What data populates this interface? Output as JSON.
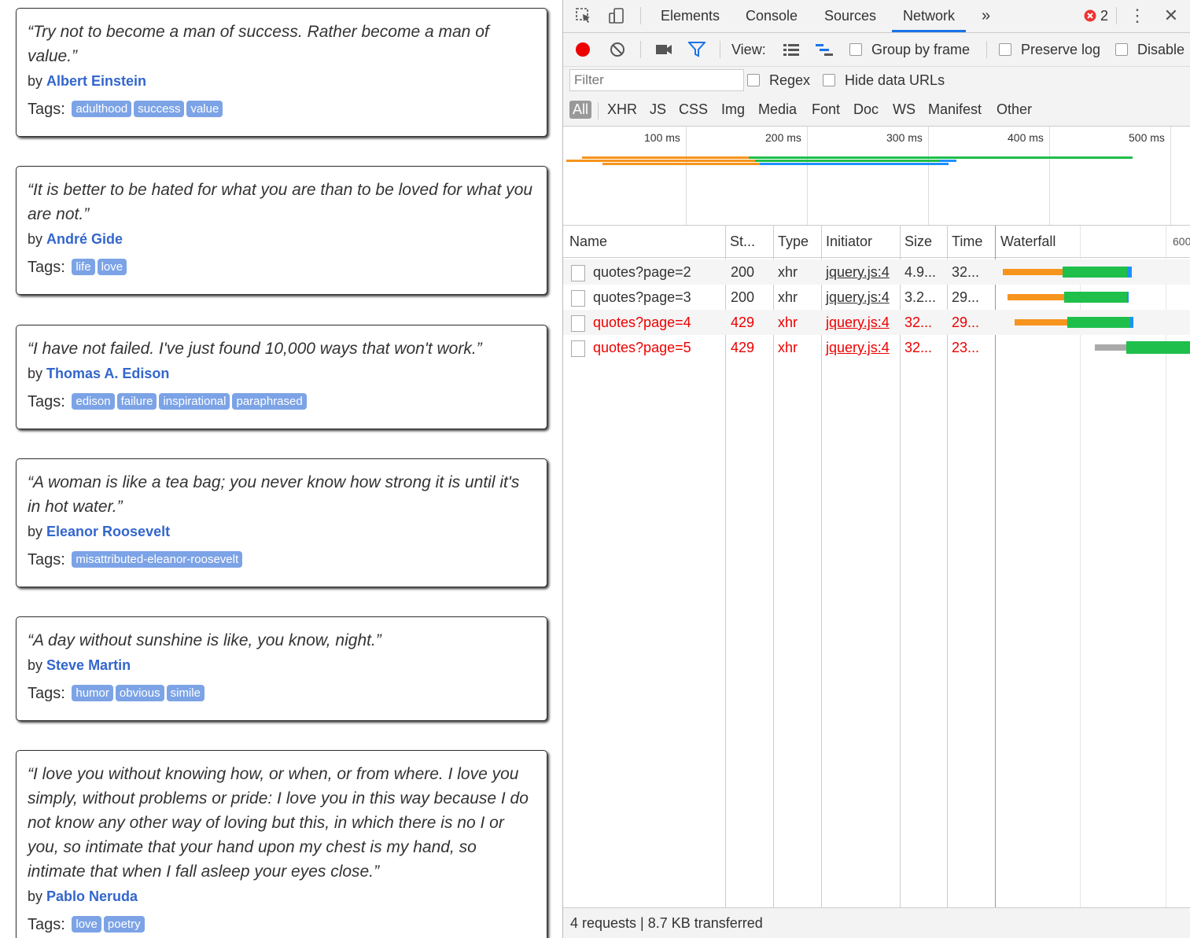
{
  "quotes": [
    {
      "text": "“Try not to become a man of success. Rather become a man of value.”",
      "by": "by",
      "author": "Albert Einstein",
      "tags_label": "Tags:",
      "tags": [
        "adulthood",
        "success",
        "value"
      ]
    },
    {
      "text": "“It is better to be hated for what you are than to be loved for what you are not.”",
      "by": "by",
      "author": "André Gide",
      "tags_label": "Tags:",
      "tags": [
        "life",
        "love"
      ]
    },
    {
      "text": "“I have not failed. I've just found 10,000 ways that won't work.”",
      "by": "by",
      "author": "Thomas A. Edison",
      "tags_label": "Tags:",
      "tags": [
        "edison",
        "failure",
        "inspirational",
        "paraphrased"
      ]
    },
    {
      "text": "“A woman is like a tea bag; you never know how strong it is until it's in hot water.”",
      "by": "by",
      "author": "Eleanor Roosevelt",
      "tags_label": "Tags:",
      "tags": [
        "misattributed-eleanor-roosevelt"
      ]
    },
    {
      "text": "“A day without sunshine is like, you know, night.”",
      "by": "by",
      "author": "Steve Martin",
      "tags_label": "Tags:",
      "tags": [
        "humor",
        "obvious",
        "simile"
      ]
    },
    {
      "text": "“I love you without knowing how, or when, or from where. I love you simply, without problems or pride: I love you in this way because I do not know any other way of loving but this, in which there is no I or you, so intimate that your hand upon my chest is my hand, so intimate that when I fall asleep your eyes close.”",
      "by": "by",
      "author": "Pablo Neruda",
      "tags_label": "Tags:",
      "tags": [
        "love",
        "poetry"
      ]
    }
  ],
  "devtools": {
    "tabs": [
      "Elements",
      "Console",
      "Sources",
      "Network"
    ],
    "active_tab": "Network",
    "more_tabs": "»",
    "error_count": "2",
    "toolbar": {
      "view_label": "View:",
      "group_by_frame": "Group by frame",
      "preserve_log": "Preserve log",
      "disable_cache": "Disable"
    },
    "filter": {
      "placeholder": "Filter",
      "regex": "Regex",
      "hide_data_urls": "Hide data URLs"
    },
    "types": [
      "All",
      "XHR",
      "JS",
      "CSS",
      "Img",
      "Media",
      "Font",
      "Doc",
      "WS",
      "Manifest",
      "Other"
    ],
    "active_type": "All",
    "overview_ticks": [
      "100 ms",
      "200 ms",
      "300 ms",
      "400 ms",
      "500 ms"
    ],
    "columns": [
      "Name",
      "St...",
      "Type",
      "Initiator",
      "Size",
      "Time",
      "Waterfall",
      "600"
    ],
    "requests": [
      {
        "name": "quotes?page=2",
        "status": "200",
        "type": "xhr",
        "initiator": "jquery.js:4",
        "size": "4.9...",
        "time": "32...",
        "error": false
      },
      {
        "name": "quotes?page=3",
        "status": "200",
        "type": "xhr",
        "initiator": "jquery.js:4",
        "size": "3.2...",
        "time": "29...",
        "error": false
      },
      {
        "name": "quotes?page=4",
        "status": "429",
        "type": "xhr",
        "initiator": "jquery.js:4",
        "size": "32...",
        "time": "29...",
        "error": true
      },
      {
        "name": "quotes?page=5",
        "status": "429",
        "type": "xhr",
        "initiator": "jquery.js:4",
        "size": "32...",
        "time": "23...",
        "error": true
      }
    ],
    "status_summary": "4 requests | 8.7 KB transferred",
    "colors": {
      "waiting": "#f7941d",
      "download": "#1fbf4b",
      "receive": "#1e90ff",
      "queued": "#aaaaaa",
      "error_text": "#ee0000",
      "accent": "#1a73e8",
      "author_link": "#3366cc",
      "tag_bg": "#7ca3e6"
    }
  }
}
